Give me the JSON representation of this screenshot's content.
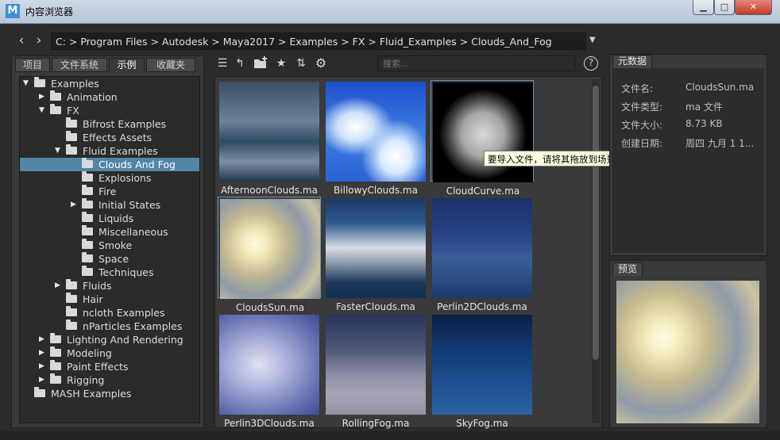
{
  "window": {
    "title": "内容浏览器",
    "logo_text": "M",
    "minimize_glyph": "▁",
    "maximize_glyph": "□",
    "close_glyph": "✕"
  },
  "path": {
    "back_icon": "‹",
    "forward_icon": "›",
    "text": "C:  >  Program Files  >  Autodesk  >  Maya2017  >  Examples  >  FX  >  Fluid_Examples  >  Clouds_And_Fog",
    "dropdown_icon": "▼"
  },
  "left_tabs": [
    "项目",
    "文件系统",
    "示例",
    "收藏夹"
  ],
  "active_left_tab": 2,
  "tree": [
    {
      "label": "Examples",
      "level": 0,
      "toggle": "▼",
      "folder": true
    },
    {
      "label": "Animation",
      "level": 1,
      "toggle": "▶",
      "folder": true
    },
    {
      "label": "FX",
      "level": 1,
      "toggle": "▼",
      "folder": true
    },
    {
      "label": "Bifrost Examples",
      "level": 2,
      "toggle": "",
      "folder": true
    },
    {
      "label": "Effects Assets",
      "level": 2,
      "toggle": "",
      "folder": true
    },
    {
      "label": "Fluid Examples",
      "level": 2,
      "toggle": "▼",
      "folder": true
    },
    {
      "label": "Clouds And Fog",
      "level": 3,
      "toggle": "",
      "folder": true,
      "selected": true
    },
    {
      "label": "Explosions",
      "level": 3,
      "toggle": "",
      "folder": true
    },
    {
      "label": "Fire",
      "level": 3,
      "toggle": "",
      "folder": true
    },
    {
      "label": "Initial States",
      "level": 3,
      "toggle": "▶",
      "folder": true
    },
    {
      "label": "Liquids",
      "level": 3,
      "toggle": "",
      "folder": true
    },
    {
      "label": "Miscellaneous",
      "level": 3,
      "toggle": "",
      "folder": true
    },
    {
      "label": "Smoke",
      "level": 3,
      "toggle": "",
      "folder": true
    },
    {
      "label": "Space",
      "level": 3,
      "toggle": "",
      "folder": true
    },
    {
      "label": "Techniques",
      "level": 3,
      "toggle": "",
      "folder": true
    },
    {
      "label": "Fluids",
      "level": 2,
      "toggle": "▶",
      "folder": true
    },
    {
      "label": "Hair",
      "level": 2,
      "toggle": "",
      "folder": true
    },
    {
      "label": "ncloth Examples",
      "level": 2,
      "toggle": "",
      "folder": true
    },
    {
      "label": "nParticles Examples",
      "level": 2,
      "toggle": "",
      "folder": true
    },
    {
      "label": "Lighting And Rendering",
      "level": 1,
      "toggle": "▶",
      "folder": true
    },
    {
      "label": "Modeling",
      "level": 1,
      "toggle": "▶",
      "folder": true
    },
    {
      "label": "Paint Effects",
      "level": 1,
      "toggle": "▶",
      "folder": true
    },
    {
      "label": "Rigging",
      "level": 1,
      "toggle": "▶",
      "folder": true
    },
    {
      "label": "MASH Examples",
      "level": 0,
      "toggle": "",
      "folder": true
    }
  ],
  "toolbar": {
    "list_icon": "☰",
    "up_icon": "↰",
    "new_folder_icon": "📁",
    "favorite_icon": "★",
    "sort_icon": "⇅",
    "settings_icon": "⚙",
    "search_placeholder": "搜索...",
    "help_icon": "?"
  },
  "thumbnails": [
    {
      "name": "AfternoonClouds.ma",
      "bg": "linear-gradient(#3a4f66,#6a8299 40%,#2f4a63 60%,#7c90a3 80%,#22384f)"
    },
    {
      "name": "BillowyClouds.ma",
      "bg": "radial-gradient(ellipse at 30% 45%,#ffffff 0,#cfe2fa 18%,transparent 38%),radial-gradient(ellipse at 70% 75%,#ffffff 0,#d9ebff 15%,transparent 35%),linear-gradient(#1f4fcc,#3b7de0 50%,#2a63d4)"
    },
    {
      "name": "CloudCurve.ma",
      "bg": "radial-gradient(ellipse at 50% 52%,#d9d9d9 0,#a6a6a6 30%,#3a3a3a 50%,#000 62%)"
    },
    {
      "name": "CloudsSun.ma",
      "bg": "radial-gradient(circle at 35% 45%,#fffbe8 0,#f2e9b8 15%,#bfb690 38%,#8f9aa8 60%,#c9c2a3 80%,#7d8898)"
    },
    {
      "name": "FasterClouds.ma",
      "bg": "linear-gradient(#1c3a66,#2d5a8f 25%,#d7dde4 50%,#8d9bab 65%,#1a3559 85%,#123056)"
    },
    {
      "name": "Perlin2DClouds.ma",
      "bg": "linear-gradient(#1a2f6a,#28468a 40%,#3a5f98 60%,#2c4e82 80%,#1c3a6e)"
    },
    {
      "name": "Perlin3DClouds.ma",
      "bg": "radial-gradient(ellipse at 40% 50%,#e0e2f3 0,#a9aed8 35%,#6a74b4 70%,#3c4a96)"
    },
    {
      "name": "RollingFog.ma",
      "bg": "linear-gradient(#28345a,#4e5778 35%,#8d8fa6 60%,#a6a4b4 80%,#9291a3)"
    },
    {
      "name": "SkyFog.ma",
      "bg": "linear-gradient(#0b2047,#133d7a 40%,#1f5494 75%,#2a63a3)"
    }
  ],
  "tooltip": "要导入文件，请将其拖放到场景中或按鼠标右键以使用导入选项",
  "metadata": {
    "tab": "元数据",
    "rows": [
      {
        "key": "文件名:",
        "value": "CloudsSun.ma"
      },
      {
        "key": "文件类型:",
        "value": "ma 文件"
      },
      {
        "key": "文件大小:",
        "value": "8.73 KB"
      },
      {
        "key": "创建日期:",
        "value": "周四 九月 1 1..."
      }
    ]
  },
  "preview": {
    "tab": "预览",
    "bg": "radial-gradient(circle at 33% 40%,#fffde9 0,#f3eab9 14%,#c4ba8e 35%,#8e9aa8 58%,#cdc4a1 78%,#7b8797)"
  }
}
